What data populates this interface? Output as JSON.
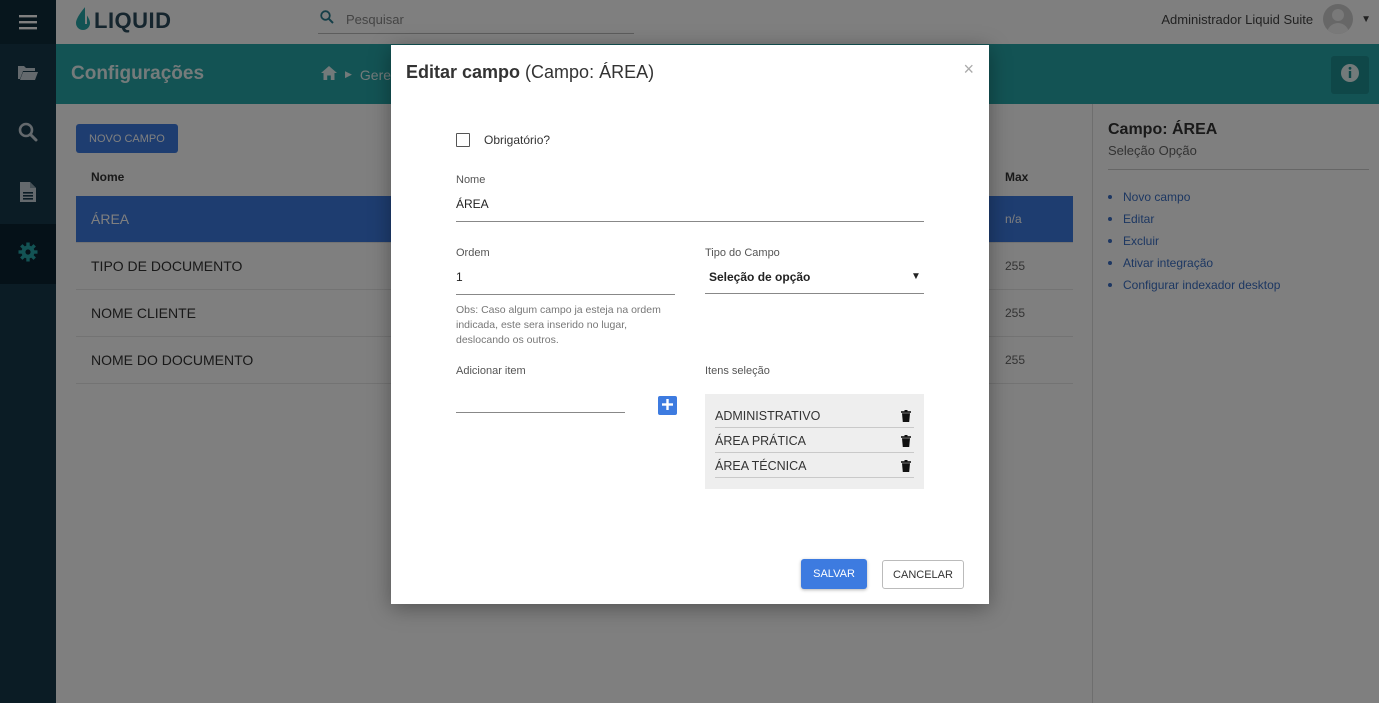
{
  "brand": {
    "logo_text": "LIQUID",
    "brand_color": "#2b4a5c"
  },
  "search": {
    "placeholder": "Pesquisar"
  },
  "user": {
    "name": "Administrador Liquid Suite"
  },
  "header": {
    "title": "Configurações",
    "breadcrumb": [
      "home-icon",
      "Gere"
    ],
    "accent": "#26a7a8"
  },
  "sidebar": {
    "items": [
      {
        "icon": "folder-open-icon"
      },
      {
        "icon": "search-icon"
      },
      {
        "icon": "document-icon"
      },
      {
        "icon": "gear-icon",
        "active": true
      }
    ]
  },
  "main": {
    "new_button": "NOVO CAMPO",
    "columns": [
      "Nome",
      "Max"
    ],
    "rows": [
      {
        "name": "ÁREA",
        "max": "n/a",
        "selected": true
      },
      {
        "name": "TIPO DE DOCUMENTO",
        "max": "255"
      },
      {
        "name": "NOME CLIENTE",
        "max": "255"
      },
      {
        "name": "NOME DO DOCUMENTO",
        "max": "255"
      }
    ]
  },
  "panel": {
    "title": "Campo: ÁREA",
    "subtitle": "Seleção Opção",
    "links": [
      "Novo campo",
      "Editar",
      "Excluir",
      "Ativar integração",
      "Configurar indexador desktop"
    ]
  },
  "modal": {
    "title_bold": "Editar campo",
    "title_rest": "(Campo: ÁREA)",
    "close": "×",
    "required_label": "Obrigatório?",
    "required_checked": false,
    "name_label": "Nome",
    "name_value": "ÁREA",
    "order_label": "Ordem",
    "order_value": "1",
    "type_label": "Tipo do Campo",
    "type_value": "Seleção de opção",
    "obs": "Obs: Caso algum campo ja esteja na ordem indicada, este sera inserido no lugar, deslocando os outros.",
    "add_item_label": "Adicionar item",
    "add_item_value": "",
    "items_label": "Itens seleção",
    "items": [
      "ADMINISTRATIVO",
      "ÁREA PRÁTICA",
      "ÁREA TÉCNICA"
    ],
    "save_label": "SALVAR",
    "cancel_label": "CANCELAR",
    "primary_color": "#3d7be0"
  }
}
